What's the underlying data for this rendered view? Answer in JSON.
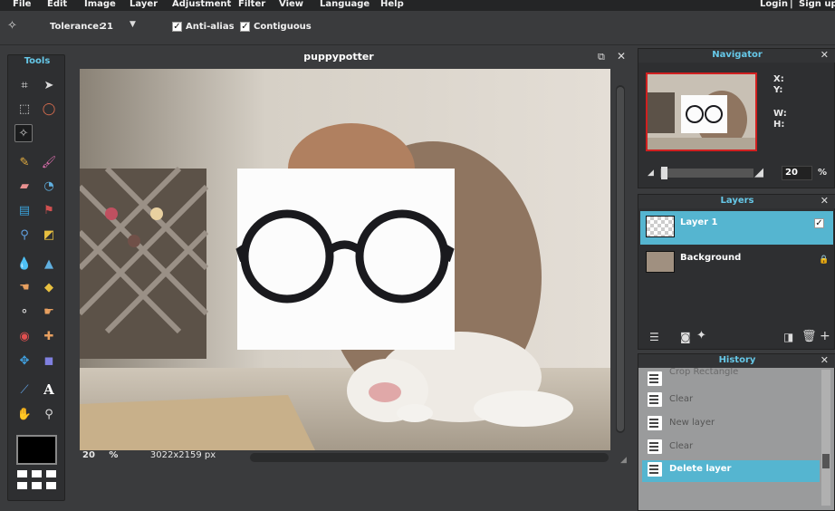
{
  "menu": {
    "items": [
      "File",
      "Edit",
      "Image",
      "Layer",
      "Adjustment",
      "Filter",
      "View",
      "Language",
      "Help"
    ],
    "login": "Login",
    "separator": "|",
    "signup": "Sign up"
  },
  "options": {
    "tool_icon": "magic-wand-icon",
    "tolerance_label": "Tolerance:",
    "tolerance_value": "21",
    "antialias_label": "Anti-alias",
    "antialias_checked": true,
    "contiguous_label": "Contiguous",
    "contiguous_checked": true
  },
  "tools": {
    "title": "Tools",
    "active": "magic-wand",
    "foreground_color": "#000000"
  },
  "document": {
    "title": "puppypotter",
    "zoom": "20",
    "zoom_unit": "%",
    "dimensions": "3022x2159 px"
  },
  "navigator": {
    "title": "Navigator",
    "x_label": "X:",
    "y_label": "Y:",
    "w_label": "W:",
    "h_label": "H:",
    "zoom_value": "20",
    "zoom_unit": "%"
  },
  "layers": {
    "title": "Layers",
    "items": [
      {
        "name": "Layer 1",
        "selected": true,
        "visible": true
      },
      {
        "name": "Background",
        "selected": false,
        "locked": true
      }
    ]
  },
  "history": {
    "title": "History",
    "items": [
      {
        "label": "Crop Rectangle",
        "selected": false
      },
      {
        "label": "Clear",
        "selected": false
      },
      {
        "label": "New layer",
        "selected": false
      },
      {
        "label": "Clear",
        "selected": false
      },
      {
        "label": "Delete layer",
        "selected": true
      }
    ]
  },
  "colors": {
    "accent": "#55b5d0",
    "panel_title": "#66c8e8",
    "background": "#3a3b3d"
  }
}
